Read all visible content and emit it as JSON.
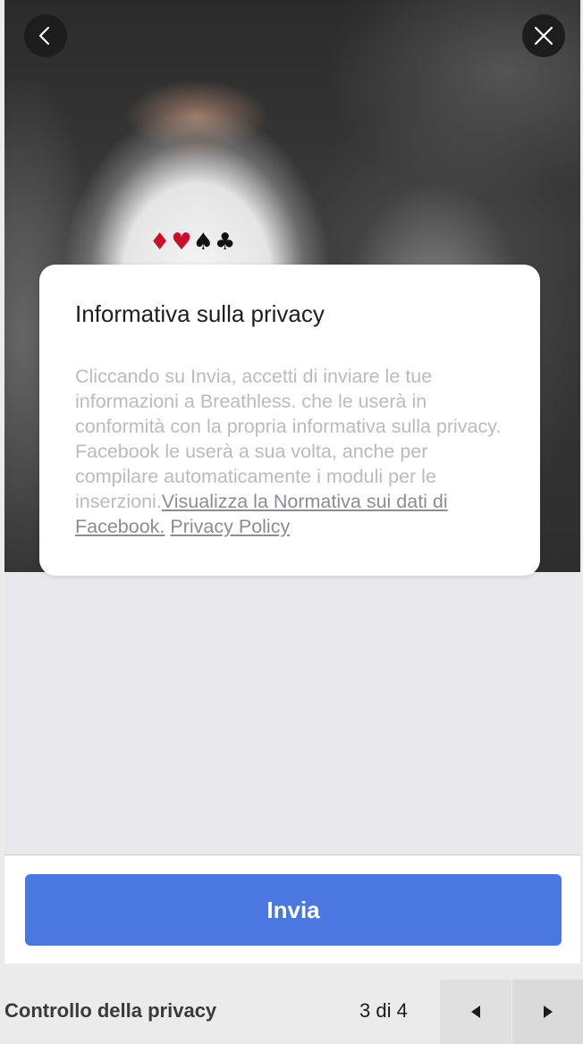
{
  "privacy": {
    "title": "Informativa sulla privacy",
    "body_text": "Cliccando su Invia, accetti di inviare le tue informazioni a Breathless. che le userà in conformità con la propria informativa sulla privacy. Facebook le userà a sua volta, anche per compilare automaticamente i moduli per le inserzioni.",
    "link_facebook_policy": "Visualizza la Normativa sui dati di Facebook.",
    "link_privacy_policy": "Privacy Policy"
  },
  "submit_label": "Invia",
  "footer": {
    "title": "Controllo della privacy",
    "page_indicator": "3 di 4"
  },
  "hero": {
    "suits": "♦♥♠♣"
  },
  "icons": {
    "back": "chevron-left-icon",
    "close": "close-icon",
    "prev": "caret-left-icon",
    "next": "caret-right-icon"
  },
  "colors": {
    "primary_button": "#4a77e0",
    "suit_red": "#c8102e",
    "body_text": "#b9bbbe",
    "link_text": "#8a8d91"
  }
}
